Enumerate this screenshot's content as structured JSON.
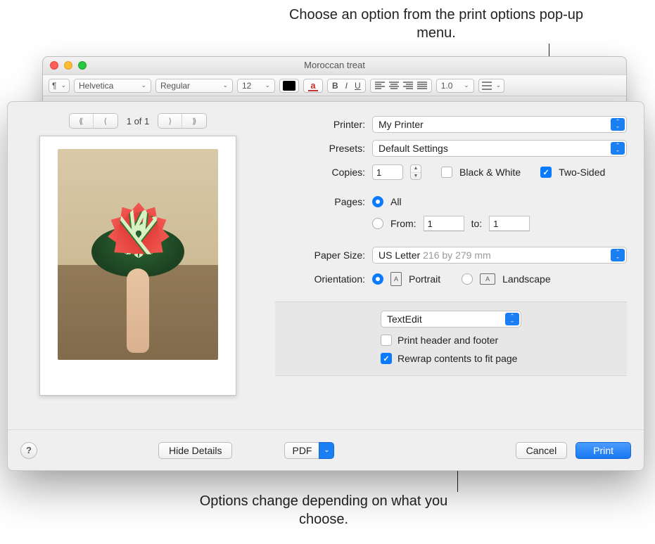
{
  "callouts": {
    "top": "Choose an option from the print options pop-up menu.",
    "bottom": "Options change depending on what you choose."
  },
  "document_window": {
    "title": "Moroccan treat",
    "toolbar": {
      "font_family": "Helvetica",
      "font_style": "Regular",
      "font_size": "12",
      "line_spacing": "1.0"
    }
  },
  "print_dialog": {
    "preview": {
      "page_indicator": "1 of 1"
    },
    "labels": {
      "printer": "Printer:",
      "presets": "Presets:",
      "copies": "Copies:",
      "black_white": "Black & White",
      "two_sided": "Two-Sided",
      "pages": "Pages:",
      "all": "All",
      "from": "From:",
      "to": "to:",
      "paper_size": "Paper Size:",
      "orientation": "Orientation:",
      "portrait": "Portrait",
      "landscape": "Landscape",
      "print_header_footer": "Print header and footer",
      "rewrap": "Rewrap contents to fit page"
    },
    "values": {
      "printer": "My Printer",
      "presets": "Default Settings",
      "copies": "1",
      "black_white_checked": false,
      "two_sided_checked": true,
      "pages_all_selected": true,
      "from": "1",
      "to": "1",
      "paper_size_name": "US Letter",
      "paper_size_dims": "216 by 279 mm",
      "orientation_portrait_selected": true,
      "app_options_menu": "TextEdit",
      "print_header_footer_checked": false,
      "rewrap_checked": true
    },
    "footer": {
      "hide_details": "Hide Details",
      "pdf": "PDF",
      "cancel": "Cancel",
      "print": "Print"
    }
  }
}
